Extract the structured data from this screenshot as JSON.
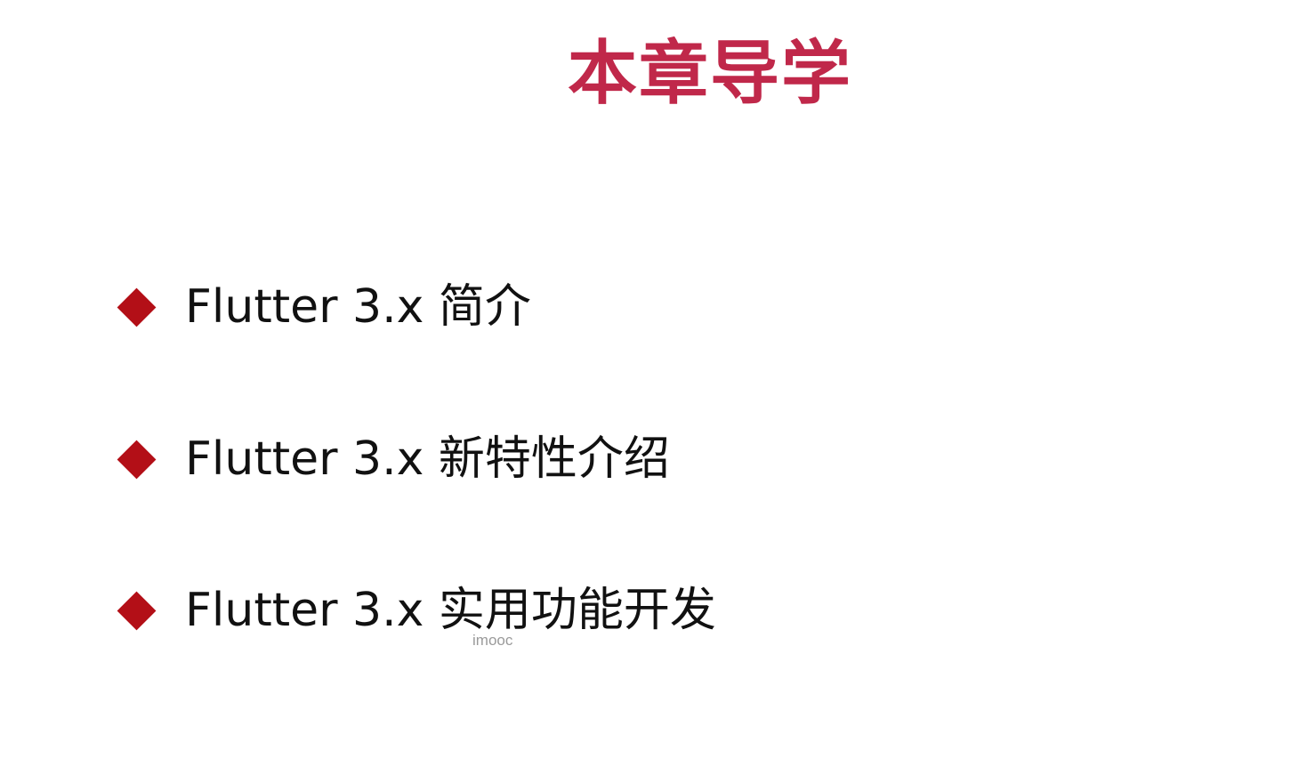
{
  "slide": {
    "title": "本章导学",
    "items": [
      {
        "text": "Flutter 3.x 简介",
        "icon": "diamond-bullet-icon"
      },
      {
        "text": "Flutter 3.x 新特性介绍",
        "icon": "diamond-bullet-icon"
      },
      {
        "text": "Flutter 3.x 实用功能开发",
        "icon": "diamond-bullet-icon"
      }
    ],
    "watermark": "imooc"
  },
  "colors": {
    "title": "#c0284a",
    "bullet": "#b30f17",
    "text": "#111111",
    "background": "#ffffff"
  }
}
